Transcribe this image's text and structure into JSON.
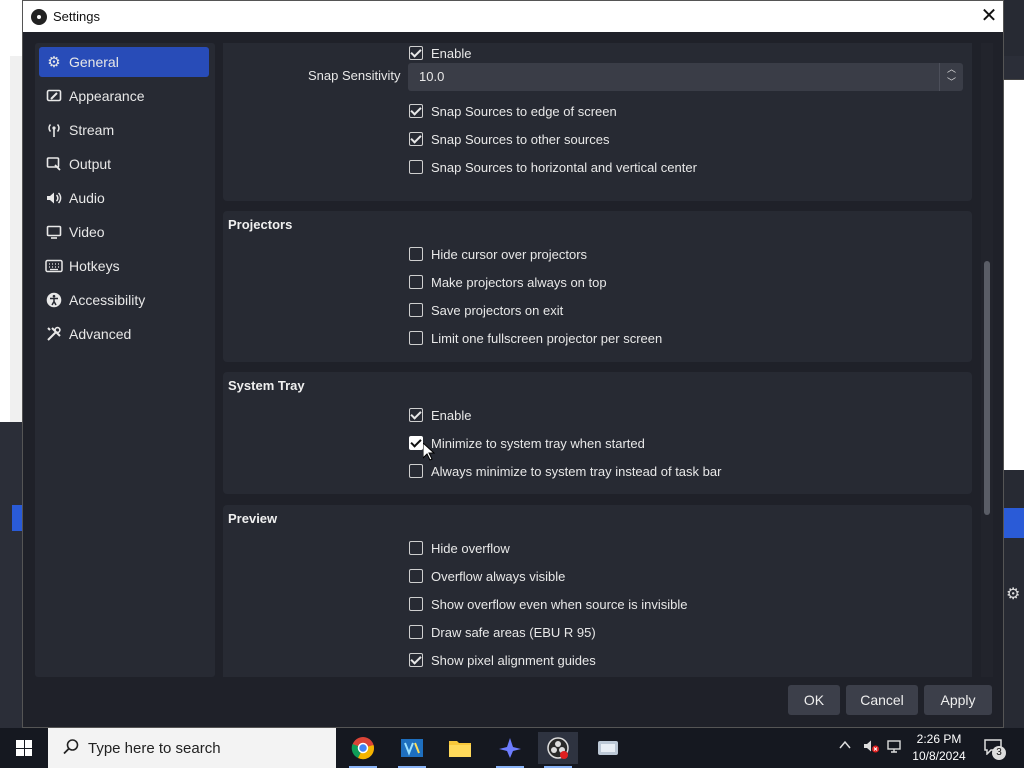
{
  "window": {
    "title": "Settings"
  },
  "sidebar": {
    "items": [
      {
        "label": "General",
        "icon": "gear-icon",
        "active": true
      },
      {
        "label": "Appearance",
        "icon": "appearance-icon"
      },
      {
        "label": "Stream",
        "icon": "broadcast-icon"
      },
      {
        "label": "Output",
        "icon": "output-icon"
      },
      {
        "label": "Audio",
        "icon": "speaker-icon"
      },
      {
        "label": "Video",
        "icon": "monitor-icon"
      },
      {
        "label": "Hotkeys",
        "icon": "keyboard-icon"
      },
      {
        "label": "Accessibility",
        "icon": "accessibility-icon"
      },
      {
        "label": "Advanced",
        "icon": "tools-icon"
      }
    ]
  },
  "snapping": {
    "enable": {
      "label": "Enable",
      "checked": true
    },
    "sensitivity_label": "Snap Sensitivity",
    "sensitivity_value": "10.0",
    "options": [
      {
        "label": "Snap Sources to edge of screen",
        "checked": true
      },
      {
        "label": "Snap Sources to other sources",
        "checked": true
      },
      {
        "label": "Snap Sources to horizontal and vertical center",
        "checked": false
      }
    ]
  },
  "projectors": {
    "title": "Projectors",
    "options": [
      {
        "label": "Hide cursor over projectors",
        "checked": false
      },
      {
        "label": "Make projectors always on top",
        "checked": false
      },
      {
        "label": "Save projectors on exit",
        "checked": false
      },
      {
        "label": "Limit one fullscreen projector per screen",
        "checked": false
      }
    ]
  },
  "system_tray": {
    "title": "System Tray",
    "options": [
      {
        "label": "Enable",
        "checked": true
      },
      {
        "label": "Minimize to system tray when started",
        "checked": true
      },
      {
        "label": "Always minimize to system tray instead of task bar",
        "checked": false
      }
    ]
  },
  "preview": {
    "title": "Preview",
    "options": [
      {
        "label": "Hide overflow",
        "checked": false
      },
      {
        "label": "Overflow always visible",
        "checked": false
      },
      {
        "label": "Show overflow even when source is invisible",
        "checked": false
      },
      {
        "label": "Draw safe areas (EBU R 95)",
        "checked": false
      },
      {
        "label": "Show pixel alignment guides",
        "checked": true
      }
    ]
  },
  "buttons": {
    "ok": "OK",
    "cancel": "Cancel",
    "apply": "Apply"
  },
  "taskbar": {
    "search_placeholder": "Type here to search",
    "time": "2:26 PM",
    "date": "10/8/2024",
    "notification_count": "3"
  },
  "colors": {
    "accent": "#284cb8",
    "panel": "#272a33",
    "window": "#1f2129"
  }
}
